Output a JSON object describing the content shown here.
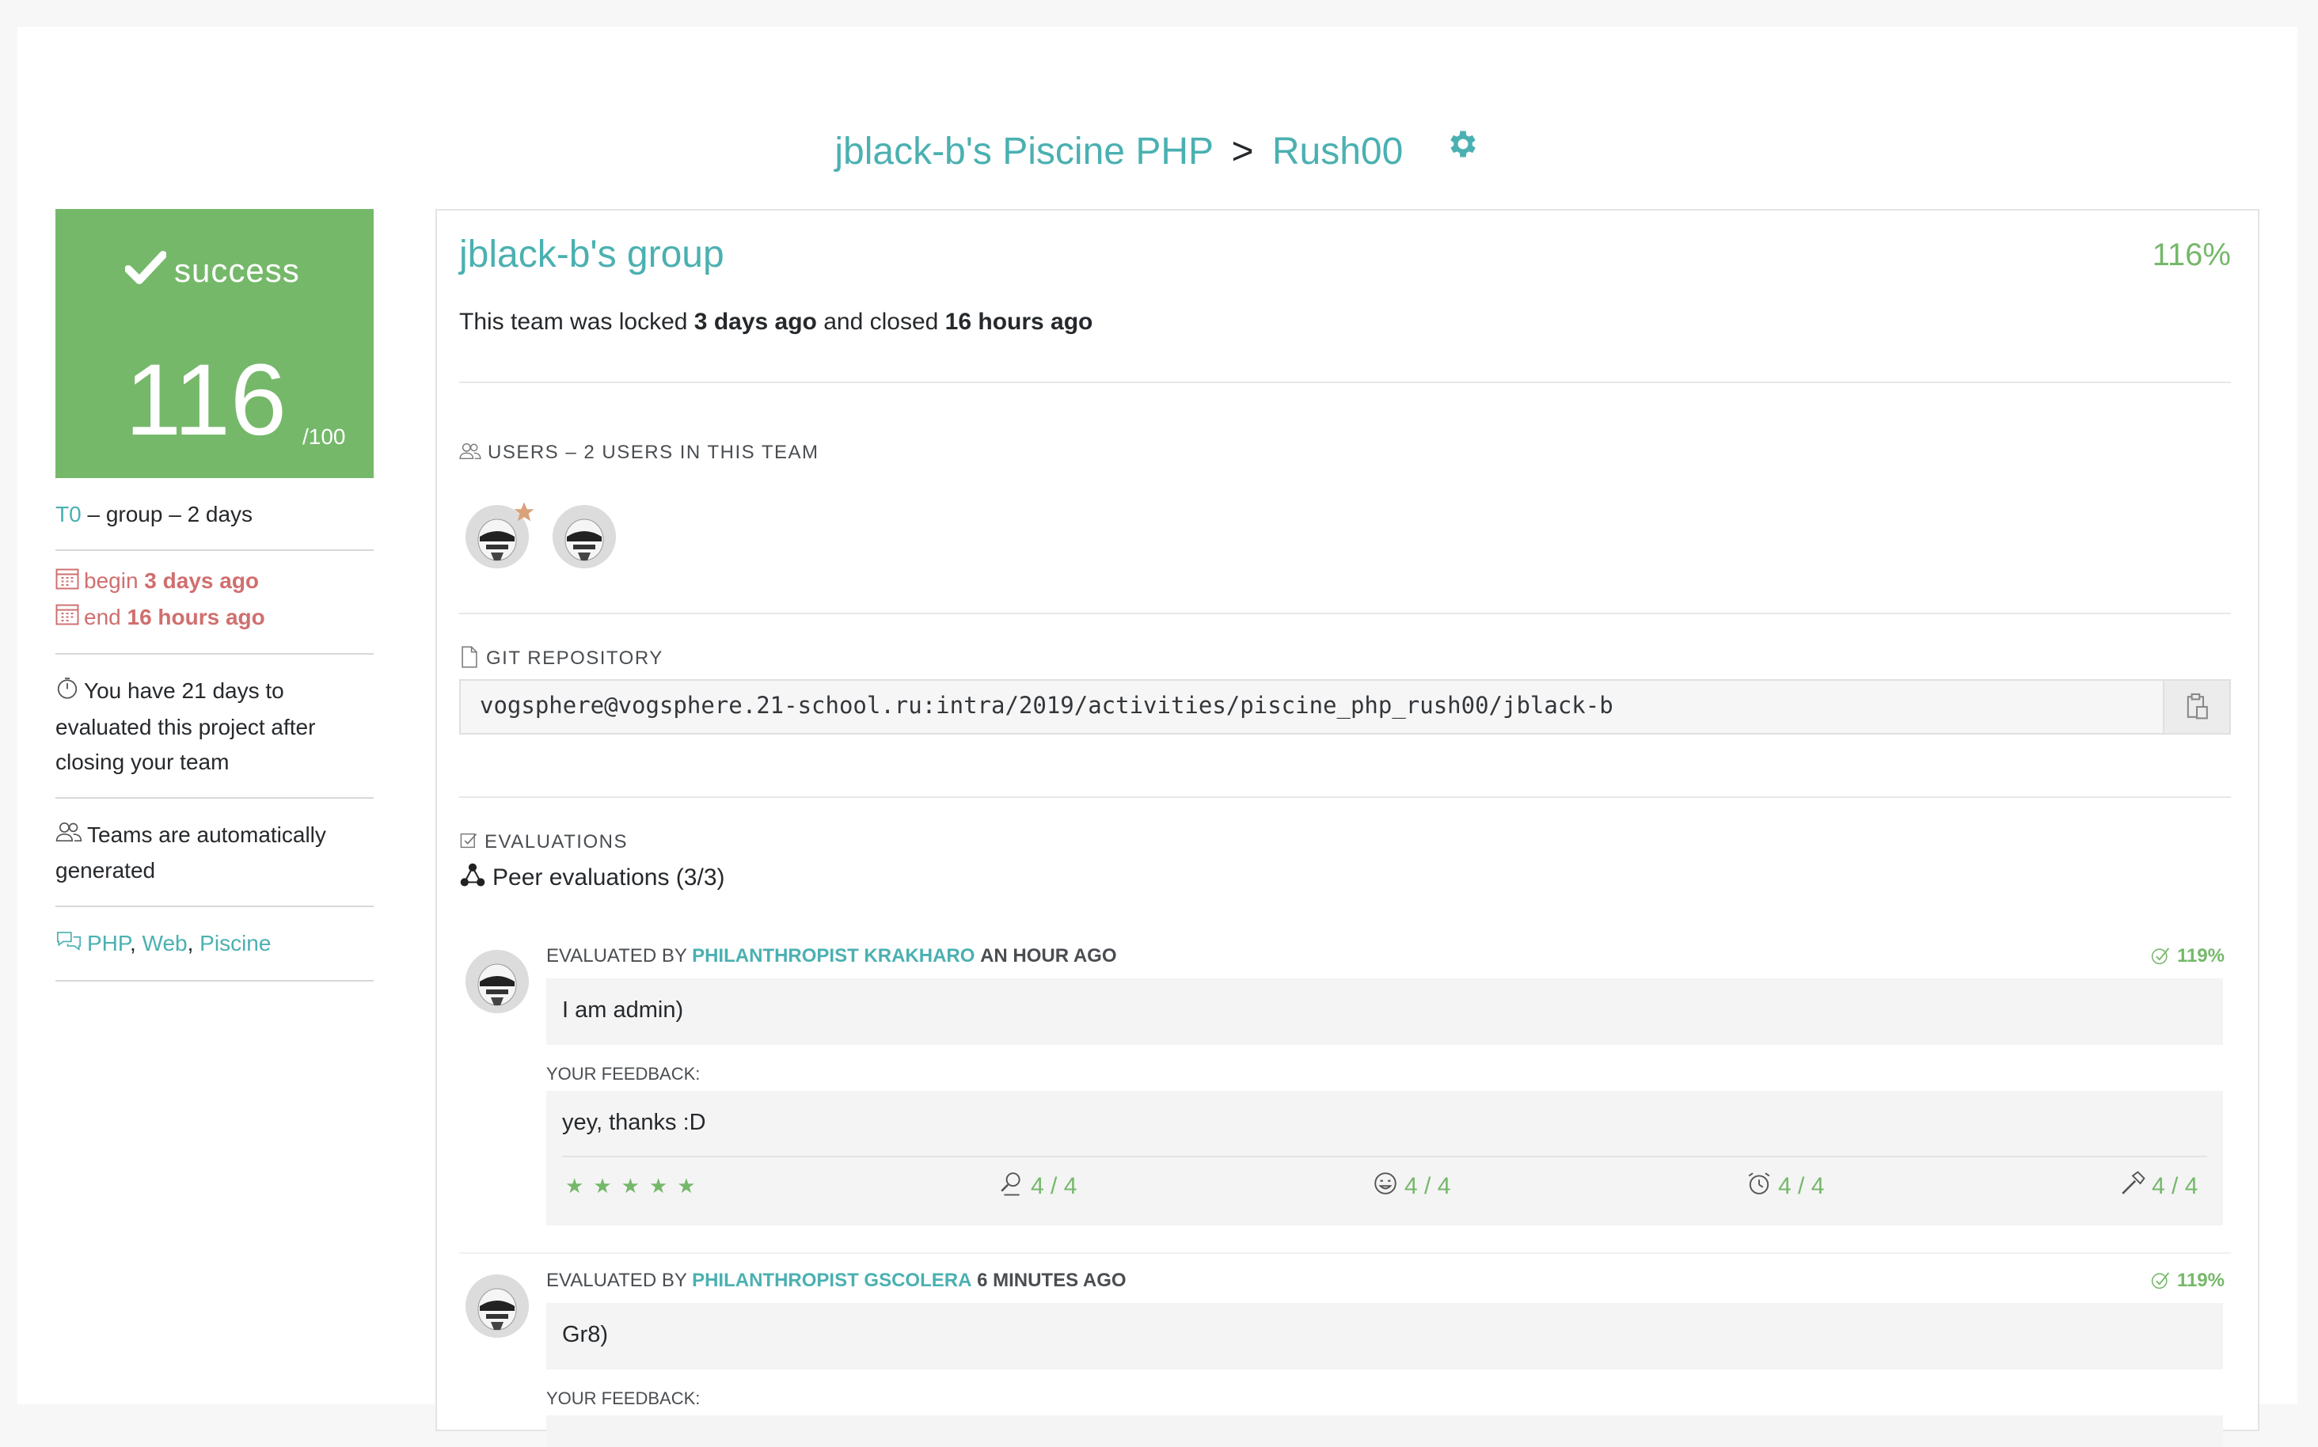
{
  "breadcrumb": {
    "piscine": "jblack-b's Piscine PHP",
    "separator": ">",
    "project": "Rush00",
    "settings_icon": "gear-icon"
  },
  "sidebar": {
    "status": "success",
    "score": "116",
    "score_max": "/100",
    "tier": "T0",
    "tier_rest": "– group – 2 days",
    "begin_label": "begin",
    "begin_value": "3 days ago",
    "end_label": "end",
    "end_value": "16 hours ago",
    "evaluate_note": "You have 21 days to evaluated this project after closing your team",
    "teams_note": "Teams are automatically generated",
    "tags": [
      "PHP",
      "Web",
      "Piscine"
    ],
    "colors": {
      "success": "#75b86a",
      "accent": "#4bb0b1",
      "danger": "#d06f6f"
    }
  },
  "group": {
    "title": "jblack-b's group",
    "percent": "116%",
    "locked_prefix": "This team was locked",
    "locked_when": "3 days ago",
    "locked_mid": "and closed",
    "closed_when": "16 hours ago"
  },
  "users": {
    "label": "Users – 2 users in this team"
  },
  "git": {
    "label": "Git repository",
    "url": "vogsphere@vogsphere.21-school.ru:intra/2019/activities/piscine_php_rush00/jblack-b",
    "copy_icon": "clipboard-icon"
  },
  "evaluations": {
    "label": "Evaluations",
    "peer_title": "Peer evaluations (3/3)",
    "items": [
      {
        "prefix": "Evaluated by",
        "evaluator": "philanthropist krakharo",
        "when": "an hour ago",
        "percent": "119%",
        "comment": "I am admin)",
        "feedback_label": "Your feedback:",
        "feedback": "yey, thanks :D",
        "stars": 5,
        "metrics": [
          "4 / 4",
          "4 / 4",
          "4 / 4",
          "4 / 4"
        ]
      },
      {
        "prefix": "Evaluated by",
        "evaluator": "philanthropist gscolera",
        "when": "6 minutes ago",
        "percent": "119%",
        "comment": "Gr8)",
        "feedback_label": "Your feedback:"
      }
    ]
  }
}
